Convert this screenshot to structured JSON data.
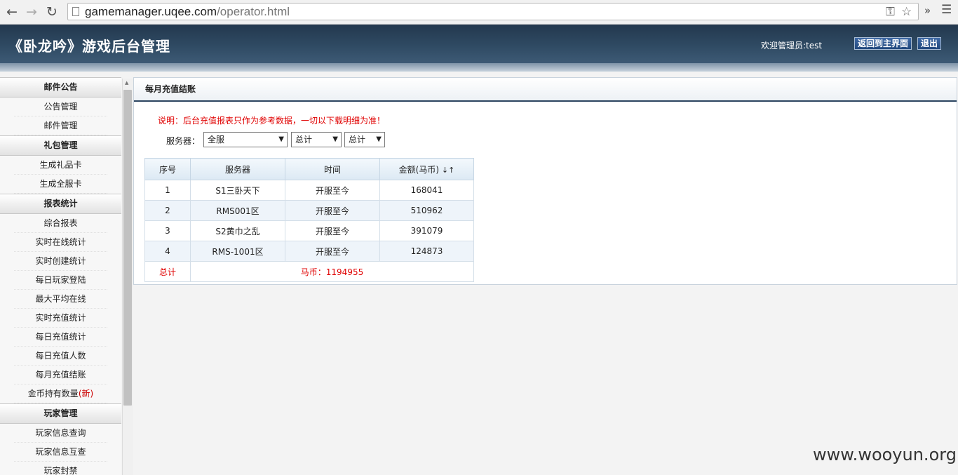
{
  "browser": {
    "url_host": "gamemanager.uqee.com",
    "url_path": "/operator.html"
  },
  "header": {
    "title": "《卧龙吟》游戏后台管理",
    "welcome": "欢迎管理员:test",
    "back_button": "返回到主界面",
    "logout_button": "退出"
  },
  "sidebar": {
    "sections": [
      {
        "title": "邮件公告",
        "items": [
          "公告管理",
          "邮件管理"
        ]
      },
      {
        "title": "礼包管理",
        "items": [
          "生成礼品卡",
          "生成全服卡"
        ]
      },
      {
        "title": "报表统计",
        "items": [
          "综合报表",
          "实时在线统计",
          "实时创建统计",
          "每日玩家登陆",
          "最大平均在线",
          "实时充值统计",
          "每日充值统计",
          "每日充值人数",
          "每月充值结账"
        ],
        "last_item": {
          "label": "金币持有数量",
          "tag": "(新)"
        }
      },
      {
        "title": "玩家管理",
        "items": [
          "玩家信息查询",
          "玩家信息互查",
          "玩家封禁"
        ]
      }
    ]
  },
  "main": {
    "title": "每月充值结账",
    "notice": "说明：后台充值报表只作为参考数据，一切以下载明细为准！",
    "filter_label": "服务器：",
    "selects": {
      "server": "全服",
      "period1": "总计",
      "period2": "总计"
    },
    "table": {
      "headers": [
        "序号",
        "服务器",
        "时间",
        "金额(马币)"
      ],
      "rows": [
        {
          "no": "1",
          "server": "S1三卧天下",
          "time": "开服至今",
          "amount": "168041"
        },
        {
          "no": "2",
          "server": "RMS001区",
          "time": "开服至今",
          "amount": "510962"
        },
        {
          "no": "3",
          "server": "S2黄巾之乱",
          "time": "开服至今",
          "amount": "391079"
        },
        {
          "no": "4",
          "server": "RMS-1001区",
          "time": "开服至今",
          "amount": "124873"
        }
      ],
      "total_label": "总计",
      "total_value": "马币：1194955"
    }
  },
  "watermark": "www.wooyun.org"
}
